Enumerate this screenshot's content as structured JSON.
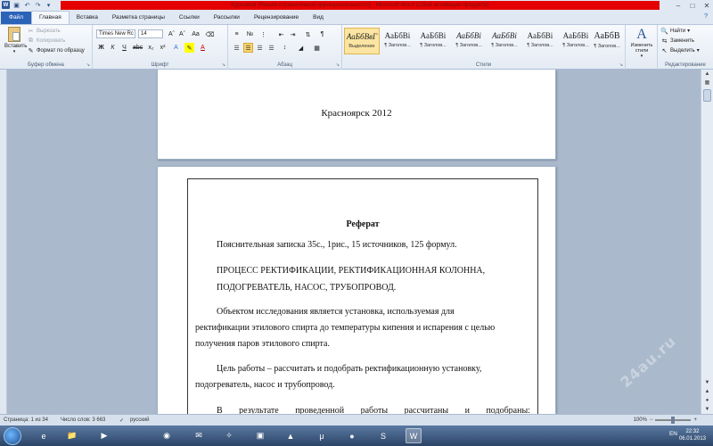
{
  "window": {
    "title": "Курсовой [Режим ограниченной функциональности] - Microsoft Word (Сбой активации продукта)"
  },
  "tabs": [
    "Файл",
    "Главная",
    "Вставка",
    "Разметка страницы",
    "Ссылки",
    "Рассылки",
    "Рецензирование",
    "Вид"
  ],
  "active_tab": "Главная",
  "ribbon": {
    "clipboard": {
      "paste": "Вставить",
      "cut": "Вырезать",
      "copy": "Копировать",
      "format_painter": "Формат по образцу",
      "label": "Буфер обмена"
    },
    "font": {
      "name": "Times New Rc",
      "size": "14",
      "label": "Шрифт"
    },
    "paragraph": {
      "label": "Абзац"
    },
    "styles": {
      "label": "Стили",
      "items": [
        {
          "sample": "АаБбВвГ",
          "name": "Выделение"
        },
        {
          "sample": "АаБбВі",
          "name": "¶ Заголов..."
        },
        {
          "sample": "АаБбВі",
          "name": "¶ Заголов..."
        },
        {
          "sample": "АаБбВі",
          "name": "¶ Заголов..."
        },
        {
          "sample": "АаБбВі",
          "name": "¶ Заголов..."
        },
        {
          "sample": "АаБбВі",
          "name": "¶ Заголов..."
        },
        {
          "sample": "АаБбВі",
          "name": "¶ Заголов..."
        },
        {
          "sample": "АаБбВ",
          "name": "¶ Заголов..."
        }
      ],
      "change_styles": "Изменить стили"
    },
    "editing": {
      "find": "Найти",
      "replace": "Заменить",
      "select": "Выделить",
      "label": "Редактирование"
    }
  },
  "document": {
    "page1_text": "Красноярск 2012",
    "heading": "Реферат",
    "line1": "Пояснительная записка 35с., 1рис., 15 источников, 125 формул.",
    "line2": "ПРОЦЕСС РЕКТИФИКАЦИИ, РЕКТИФИКАЦИОННАЯ КОЛОННА,",
    "line3": "ПОДОГРЕВАТЕЛЬ, НАСОС, ТРУБОПРОВОД.",
    "line4": "Объектом исследования является установка, используемая для",
    "line5": "ректификации этилового спирта до температуры кипения и испарения с целью",
    "line6": "получения паров этилового спирта.",
    "line7": "Цель работы – рассчитать и подобрать ректификационную установку,",
    "line8": "подогреватель, насос и трубопровод.",
    "line9_words": [
      "В",
      "результате",
      "проведенной",
      "работы",
      "рассчитаны",
      "и",
      "подобраны:"
    ]
  },
  "status": {
    "page": "Страница: 1 из 34",
    "words": "Число слов: 3 663",
    "lang": "русский",
    "zoom": "100%"
  },
  "taskbar": {
    "lang": "EN",
    "time": "22:32",
    "date": "06.01.2013"
  },
  "watermark": "24au.ru"
}
